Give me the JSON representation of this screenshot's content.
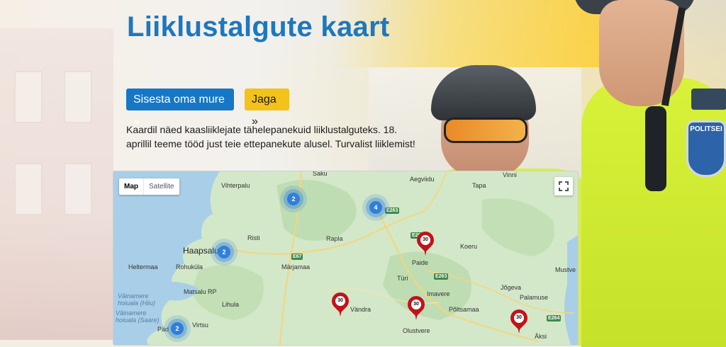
{
  "header": {
    "title": "Liiklustalgute kaart"
  },
  "actions": {
    "submit_label": "Sisesta oma mure »",
    "share_label": "Jaga »"
  },
  "intro_text": "Kaardil näed kaasliiklejate tähelepanekuid liiklustalguteks. 18. aprillil teeme tööd just teie ettepanekute alusel. Turvalist liiklemist!",
  "badge_text": "POLITSEI",
  "map": {
    "type_control": {
      "map_label": "Map",
      "satellite_label": "Satellite"
    },
    "fullscreen_icon": "fullscreen-icon",
    "places": [
      "Vihterpalu",
      "Saku",
      "Aegviidu",
      "Tapa",
      "Vinni",
      "Risti",
      "Rapla",
      "Koeru",
      "Haapsalu",
      "Heltermaa",
      "Rohuküla",
      "Märjamaa",
      "Paide",
      "Türi",
      "Mustve",
      "Väinamere hoiuala (Hiiu)",
      "Väinamere hoiuala (Saare)",
      "Matsalu RP",
      "Lihula",
      "Imavere",
      "Jõgeva",
      "Palamuse",
      "Vändra",
      "Põltsamaa",
      "Olustvere",
      "Virtsu",
      "Päd",
      "Äksi"
    ],
    "roads": [
      "E263",
      "E67",
      "E263",
      "E263",
      "E264"
    ],
    "clusters": [
      {
        "count": "2"
      },
      {
        "count": "4"
      },
      {
        "count": "2"
      },
      {
        "count": "2"
      }
    ],
    "markers": [
      {
        "sign": "30"
      },
      {
        "sign": "30"
      },
      {
        "sign": "30"
      },
      {
        "sign": "30"
      }
    ],
    "colors": {
      "cluster": "#2f7fdc",
      "marker": "#c4121a",
      "land": "#cfe6c6",
      "water": "#a9cfe8"
    }
  },
  "colors": {
    "title": "#1c78bf",
    "primary_button": "#1677c6",
    "share_button": "#f3c21b"
  }
}
